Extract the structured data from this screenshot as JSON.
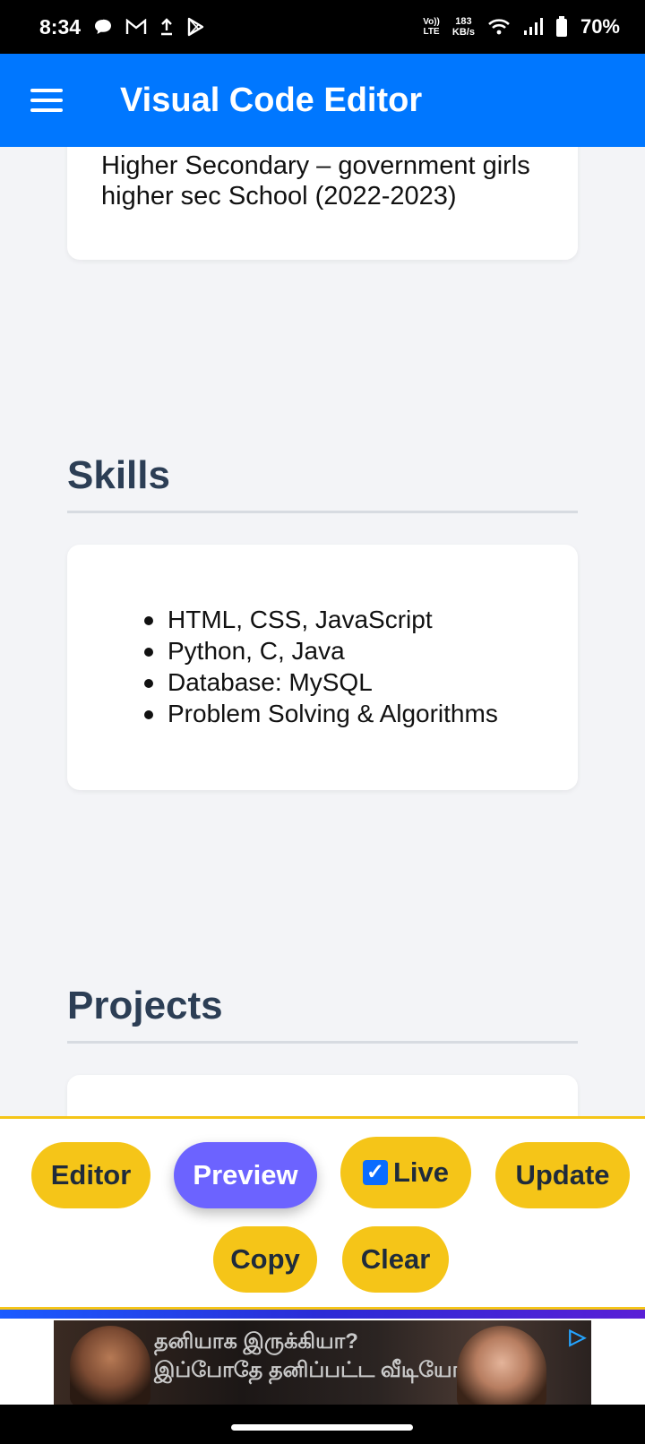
{
  "status_bar": {
    "time": "8:34",
    "volte_top": "Vo))",
    "volte_bottom": "LTE",
    "net_speed_value": "183",
    "net_speed_unit": "KB/s",
    "battery": "70%"
  },
  "app_bar": {
    "title": "Visual Code Editor"
  },
  "education": {
    "text_line1": "Higher Secondary – government girls",
    "text_line2": "higher sec School (2022-2023)"
  },
  "skills": {
    "title": "Skills",
    "items": [
      "HTML, CSS, JavaScript",
      "Python, C, Java",
      "Database: MySQL",
      "Problem Solving & Algorithms"
    ]
  },
  "projects": {
    "title": "Projects"
  },
  "toolbar": {
    "editor": "Editor",
    "preview": "Preview",
    "live": "Live",
    "live_checked": true,
    "update": "Update",
    "copy": "Copy",
    "clear": "Clear"
  },
  "ad": {
    "line1": "தனியாக இருக்கியா?",
    "line2": "இப்போதே தனிப்பட்ட வீடியோ"
  },
  "colors": {
    "app_bar": "#0077ff",
    "pill": "#f5c518",
    "pill_active": "#6c63ff",
    "section_title": "#2c3e55"
  }
}
